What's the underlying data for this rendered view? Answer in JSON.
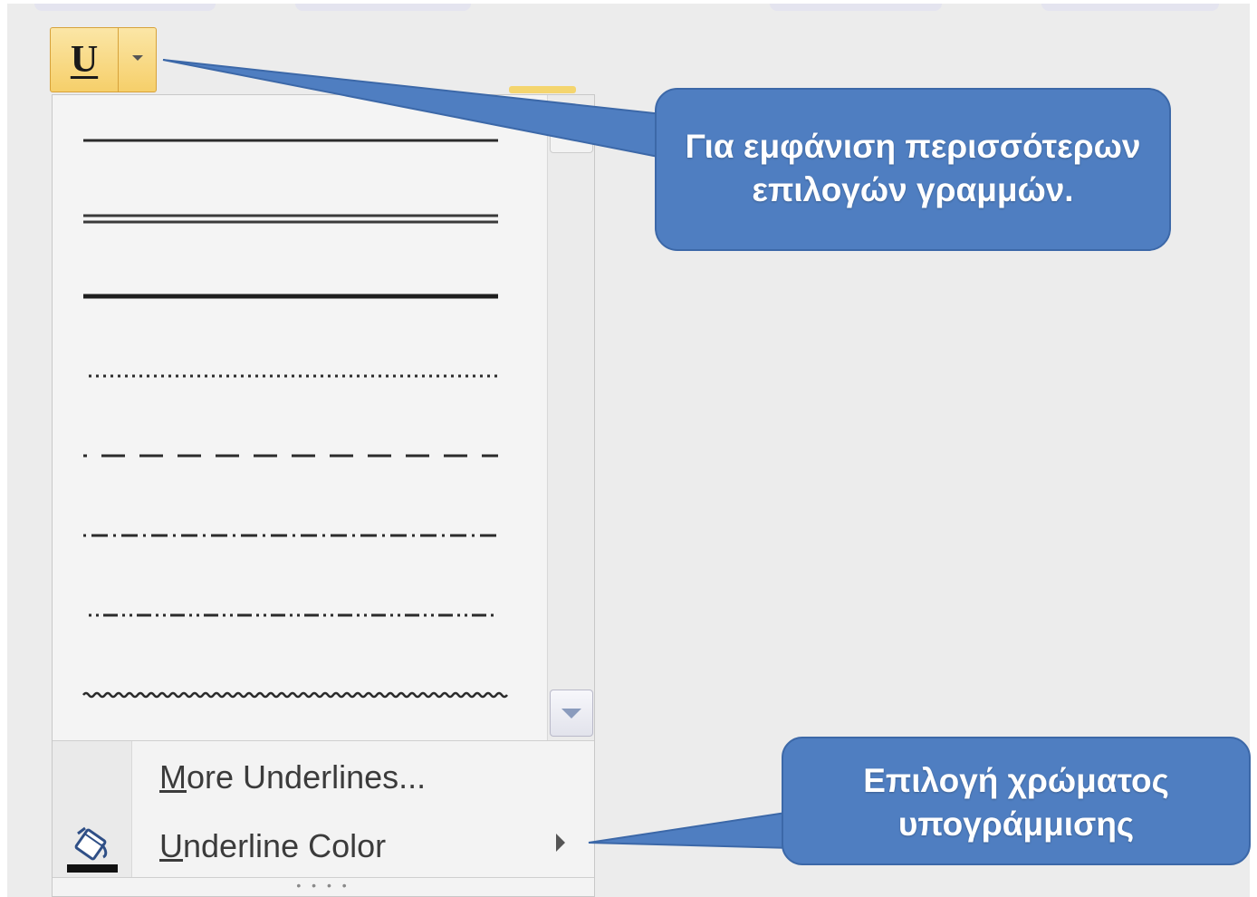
{
  "toolbar": {
    "underline_button": {
      "glyph": "U",
      "icon": "underline-icon",
      "dropdown_icon": "chevron-down-icon"
    }
  },
  "underline_gallery": {
    "styles": [
      {
        "style": "single"
      },
      {
        "style": "double"
      },
      {
        "style": "thick"
      },
      {
        "style": "dotted"
      },
      {
        "style": "dashed"
      },
      {
        "style": "dot-dash"
      },
      {
        "style": "dot-dot-dash"
      },
      {
        "style": "wave"
      }
    ],
    "scroll_down_icon": "chevron-down-icon"
  },
  "menu": {
    "more_underlines": "More Underlines...",
    "more_underlines_access_key": "M",
    "underline_color": "Underline Color",
    "underline_color_access_key": "U",
    "underline_color_icon": "paint-bucket-icon",
    "underline_color_submenu_icon": "chevron-right-icon"
  },
  "callouts": {
    "more_lines_line1": "Για εμφάνιση περισσότερων",
    "more_lines_line2": "επιλογών γραμμών.",
    "color_line1": "Επιλογή χρώματος",
    "color_line2": "υπογράμμισης"
  },
  "colors": {
    "callout_fill": "#4f7ec1",
    "callout_border": "#3c68a8",
    "button_highlight": "#f6cf6a",
    "background": "#ececec"
  }
}
